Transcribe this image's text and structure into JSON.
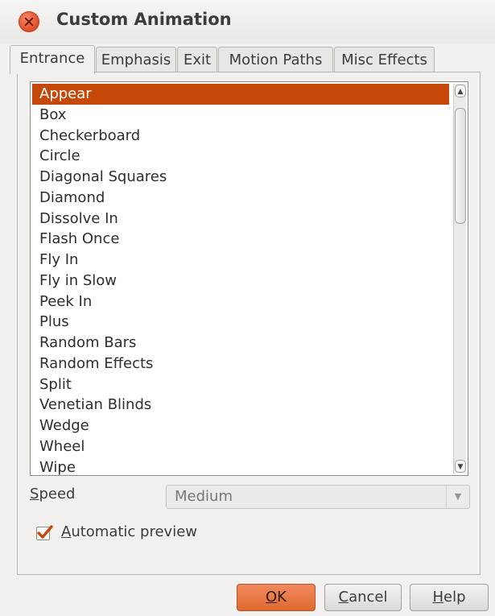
{
  "window": {
    "title": "Custom Animation"
  },
  "tabs": [
    {
      "label": "Entrance",
      "active": true
    },
    {
      "label": "Emphasis",
      "active": false
    },
    {
      "label": "Exit",
      "active": false
    },
    {
      "label": "Motion Paths",
      "active": false
    },
    {
      "label": "Misc Effects",
      "active": false
    }
  ],
  "effects": {
    "selected": "Appear",
    "items": [
      "Appear",
      "Box",
      "Checkerboard",
      "Circle",
      "Diagonal Squares",
      "Diamond",
      "Dissolve In",
      "Flash Once",
      "Fly In",
      "Fly in Slow",
      "Peek In",
      "Plus",
      "Random Bars",
      "Random Effects",
      "Split",
      "Venetian Blinds",
      "Wedge",
      "Wheel",
      "Wipe"
    ]
  },
  "speed": {
    "label": "Speed",
    "mnemonic": "S",
    "rest": "peed",
    "value": "Medium"
  },
  "automatic_preview": {
    "label": "Automatic preview",
    "mnemonic": "A",
    "rest": "utomatic preview",
    "checked": true
  },
  "buttons": {
    "ok": {
      "label": "OK",
      "mnemonic": "O",
      "rest": "K"
    },
    "cancel": {
      "label": "Cancel",
      "mnemonic": "C",
      "rest": "ancel"
    },
    "help": {
      "label": "Help",
      "mnemonic": "H",
      "rest": "elp"
    }
  },
  "colors": {
    "accent": "#c64808",
    "ok_button": "#e8743a",
    "close_button": "#e0522e"
  }
}
